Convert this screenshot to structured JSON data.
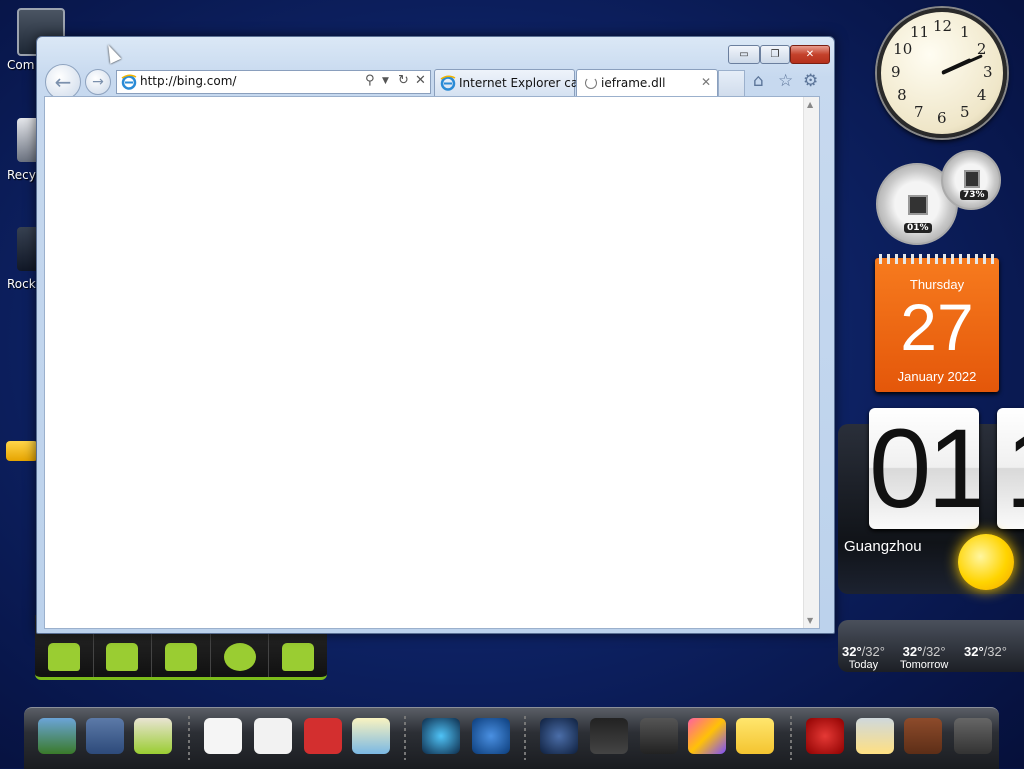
{
  "desktop": {
    "icons": [
      {
        "label": "Com"
      },
      {
        "label": "Recy"
      },
      {
        "label": "Rock"
      }
    ]
  },
  "browser": {
    "address": "http://bing.com/",
    "tabs": [
      {
        "label": "Internet Explorer ca..."
      },
      {
        "label": "ieframe.dll"
      }
    ],
    "caption_buttons": {
      "minimize": "▭",
      "maximize": "❐",
      "close": "✕"
    }
  },
  "gadgets": {
    "clock": {
      "numbers": [
        "12",
        "1",
        "2",
        "3",
        "4",
        "5",
        "6",
        "7",
        "8",
        "9",
        "10",
        "11"
      ],
      "hour": 2,
      "minute": 11
    },
    "cpu_meter": {
      "cpu": "01%",
      "memory": "73%"
    },
    "calendar": {
      "weekday": "Thursday",
      "day": "27",
      "month_year": "January 2022"
    },
    "flip_clock": {
      "hour": "01",
      "minute": "1"
    },
    "weather": {
      "city": "Guangzhou",
      "forecast": [
        {
          "high": "32°",
          "low": "/32°",
          "day": "Today"
        },
        {
          "high": "32°",
          "low": "/32°",
          "day": "Tomorrow"
        },
        {
          "high": "32°",
          "low": "/32°",
          "day": ""
        }
      ]
    }
  },
  "dock": {
    "items": [
      "gallery-icon",
      "globe-photo-icon",
      "android-folder-icon",
      "play-store-icon",
      "gmail-icon",
      "youtube-icon",
      "maps-icon",
      "camera-icon",
      "browser-globe-icon",
      "speaker-icon",
      "color-app-icon",
      "calculator-icon",
      "photo-frame-icon",
      "notes-icon",
      "angry-birds-icon",
      "weather-icon",
      "cookie-icon",
      "trash-icon"
    ]
  },
  "colors": {
    "calendar": "#f26b12",
    "android_green": "#9acd32",
    "desktop_blue": "#0e2366"
  }
}
